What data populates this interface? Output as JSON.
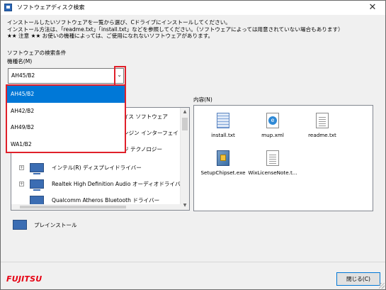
{
  "window": {
    "title": "ソフトウェアディスク検索",
    "close_glyph": "✕"
  },
  "instructions": {
    "line1": "インストールしたいソフトウェアを一覧から選び、Cドライブにインストールしてください。",
    "line2": "インストール方法は、「readme.txt」「install.txt」などを参照してください。（ソフトウェアによっては用意されていない場合もあります）",
    "line3": "★★ 注意 ★★ お使いの機種によっては、ご使用になれないソフトウェアがあります。"
  },
  "search": {
    "section_label": "ソフトウェアの検索条件",
    "model_label": "機種名(M)",
    "selected": "AH45/B2",
    "options": [
      "AH45/B2",
      "AH42/B2",
      "AH49/B2",
      "WA1/B2"
    ]
  },
  "tree": {
    "partial_rows": [
      "イス ソフトウェア",
      "ンジン インターフェイ",
      "ジ テクノロジー"
    ],
    "rows": [
      "インテル(R) ディスプレイドライバー",
      "Realtek High Definition Audio オーディオドライバー",
      "Qualcomm Atheros Bluetooth ドライバー"
    ]
  },
  "contents": {
    "label": "内容(N)",
    "files": [
      {
        "name": "install.txt",
        "icon": "text-grid-icon"
      },
      {
        "name": "mup.xml",
        "icon": "xml-file-icon"
      },
      {
        "name": "readme.txt",
        "icon": "text-file-icon"
      },
      {
        "name": "SetupChipset.exe",
        "icon": "setup-exe-icon"
      },
      {
        "name": "WixLicenseNote.t...",
        "icon": "text-file-icon"
      }
    ]
  },
  "preinstall_label": "プレインストール",
  "brand": "FUJITSU",
  "buttons": {
    "close": "閉じる(C)"
  },
  "colors": {
    "selection": "#0078d7",
    "highlight_frame": "#e0202a",
    "brand_red": "#e60012"
  }
}
